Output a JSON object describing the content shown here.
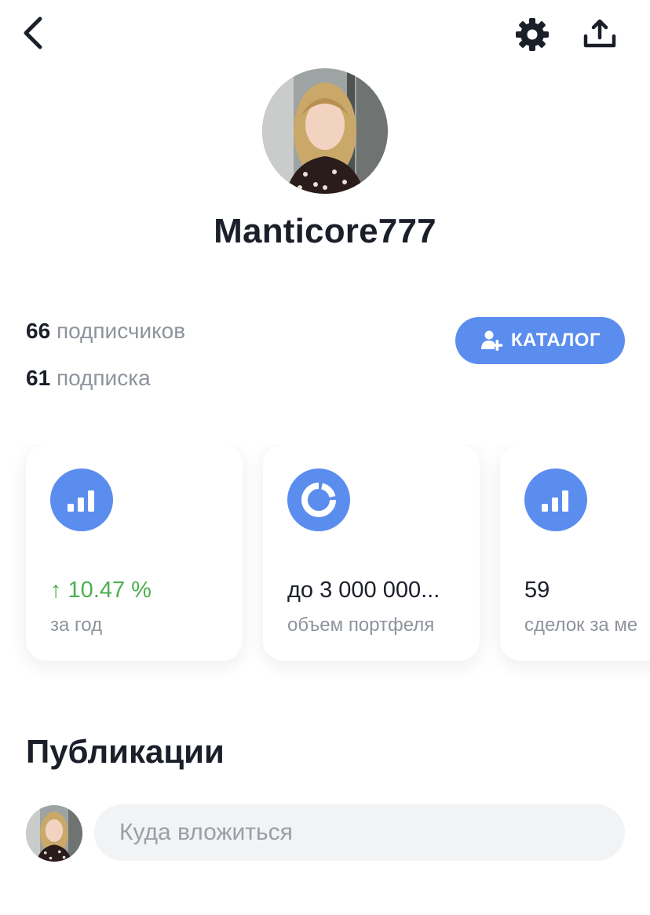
{
  "header": {
    "back_icon": "chevron-left-icon",
    "settings_icon": "gear-icon",
    "share_icon": "share-upload-icon"
  },
  "profile": {
    "username": "Manticore777",
    "followers": {
      "count": "66",
      "label": "подписчиков"
    },
    "following": {
      "count": "61",
      "label": "подписка"
    },
    "catalog_button": {
      "label": "КАТАЛОГ",
      "icon": "add-user-icon"
    }
  },
  "stats_cards": [
    {
      "icon": "bar-chart-icon",
      "value": "↑ 10.47 %",
      "label": "за год",
      "value_color": "#4caf50"
    },
    {
      "icon": "donut-chart-icon",
      "value": "до 3 000 000...",
      "label": "объем портфеля"
    },
    {
      "icon": "bar-chart-icon",
      "value": "59",
      "label": "сделок за ме"
    }
  ],
  "publications": {
    "title": "Публикации",
    "input_placeholder": "Куда вложиться"
  },
  "colors": {
    "accent": "#5b8def",
    "positive": "#4caf50",
    "text_primary": "#1b1f2a",
    "text_secondary": "#8e939c"
  }
}
